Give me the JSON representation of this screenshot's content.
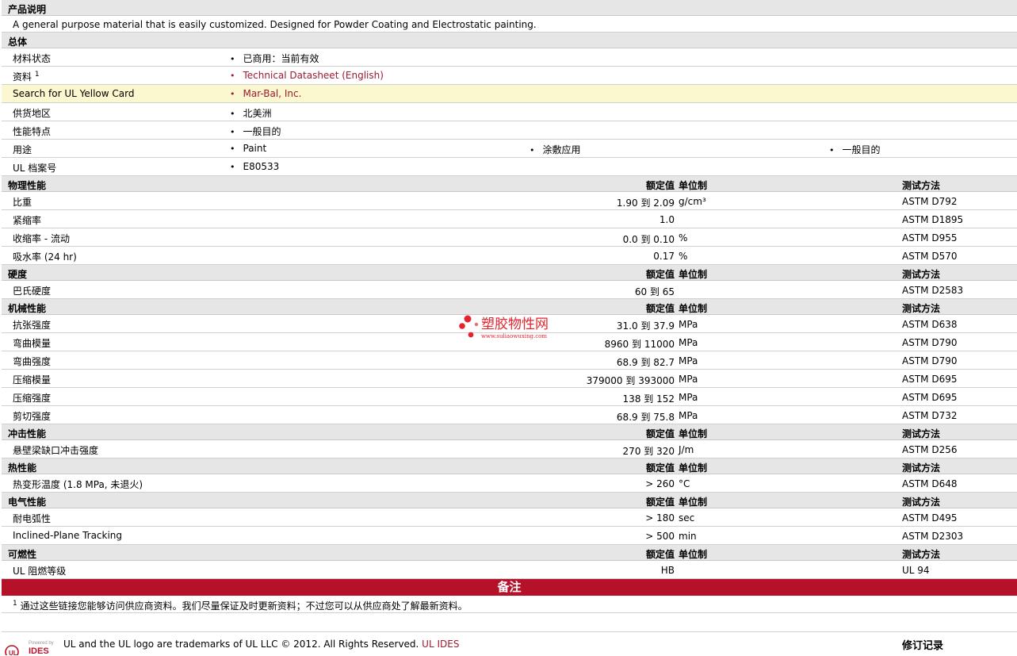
{
  "description": {
    "header": "产品说明",
    "text": "A general purpose material that is easily customized. Designed for Powder Coating and Electrostatic painting."
  },
  "general": {
    "header": "总体",
    "rows": [
      {
        "label": "材料状态",
        "items": [
          "已商用：当前有效"
        ]
      },
      {
        "label": "资料",
        "sup": "1",
        "items": [
          "Technical Datasheet (English)"
        ],
        "link": true
      },
      {
        "label": "Search for UL Yellow Card",
        "items": [
          "Mar-Bal, Inc."
        ],
        "link": true
      },
      {
        "label": "供货地区",
        "items": [
          "北美洲"
        ]
      },
      {
        "label": "性能特点",
        "items": [
          "一般目的"
        ]
      },
      {
        "label": "用途",
        "items": [
          "Paint",
          "涂敷应用",
          "一般目的"
        ]
      },
      {
        "label": "UL 档案号",
        "items": [
          "E80533"
        ]
      }
    ]
  },
  "columns": {
    "nominal": "额定值",
    "unit": "单位制",
    "method": "测试方法"
  },
  "sections": [
    {
      "title": "物理性能",
      "rows": [
        {
          "label": "比重",
          "value": "1.90 到  2.09",
          "unit": "g/cm³",
          "method": "ASTM D792"
        },
        {
          "label": "紧缩率",
          "value": "1.0",
          "unit": "",
          "method": "ASTM D1895"
        },
        {
          "label": "收缩率  - 流动",
          "value": "0.0 到  0.10",
          "unit": "%",
          "method": "ASTM D955"
        },
        {
          "label": "吸水率  (24 hr)",
          "value": "0.17",
          "unit": "%",
          "method": "ASTM D570"
        }
      ]
    },
    {
      "title": "硬度",
      "rows": [
        {
          "label": "巴氏硬度",
          "value": "60 到  65",
          "unit": "",
          "method": "ASTM D2583"
        }
      ]
    },
    {
      "title": "机械性能",
      "rows": [
        {
          "label": "抗张强度",
          "value": "31.0 到  37.9",
          "unit": "MPa",
          "method": "ASTM D638"
        },
        {
          "label": "弯曲模量",
          "value": "8960 到  11000",
          "unit": "MPa",
          "method": "ASTM D790"
        },
        {
          "label": "弯曲强度",
          "value": "68.9 到  82.7",
          "unit": "MPa",
          "method": "ASTM D790"
        },
        {
          "label": "压缩模量",
          "value": "379000 到  393000",
          "unit": "MPa",
          "method": "ASTM D695"
        },
        {
          "label": "压缩强度",
          "value": "138 到  152",
          "unit": "MPa",
          "method": "ASTM D695"
        },
        {
          "label": "剪切强度",
          "value": "68.9 到  75.8",
          "unit": "MPa",
          "method": "ASTM D732"
        }
      ]
    },
    {
      "title": "冲击性能",
      "rows": [
        {
          "label": "悬壁梁缺口冲击强度",
          "value": "270 到  320",
          "unit": "J/m",
          "method": "ASTM D256"
        }
      ]
    },
    {
      "title": "热性能",
      "rows": [
        {
          "label": "热变形温度  (1.8 MPa, 未退火)",
          "value": "> 260",
          "unit": "°C",
          "method": "ASTM D648"
        }
      ]
    },
    {
      "title": "电气性能",
      "rows": [
        {
          "label": "耐电弧性",
          "value": "> 180",
          "unit": "sec",
          "method": "ASTM D495"
        },
        {
          "label": "Inclined-Plane Tracking",
          "value": "> 500",
          "unit": "min",
          "method": "ASTM D2303"
        }
      ]
    },
    {
      "title": "可燃性",
      "rows": [
        {
          "label": "UL 阻燃等级",
          "value": "HB",
          "unit": "",
          "method": "UL 94"
        }
      ]
    }
  ],
  "notes": {
    "header": "备注",
    "sup": "1",
    "text": "通过这些链接您能够访问供应商资料。我们尽量保证及时更新资料；不过您可以从供应商处了解最新资料。"
  },
  "footer": {
    "logo_top": "Powered by",
    "logo_main": "IDES",
    "text": "UL and the UL logo are trademarks of UL LLC © 2012. All Rights Reserved. ",
    "link": "UL IDES",
    "revision": "修订记录"
  },
  "watermark": {
    "name": "塑胶物性网",
    "url": "www.suliaowuxing.com"
  },
  "colors": {
    "accent": "#b5122a",
    "link": "#9b1b30",
    "highlight": "#fbf7cf",
    "header_bg": "#e6e6e6"
  }
}
